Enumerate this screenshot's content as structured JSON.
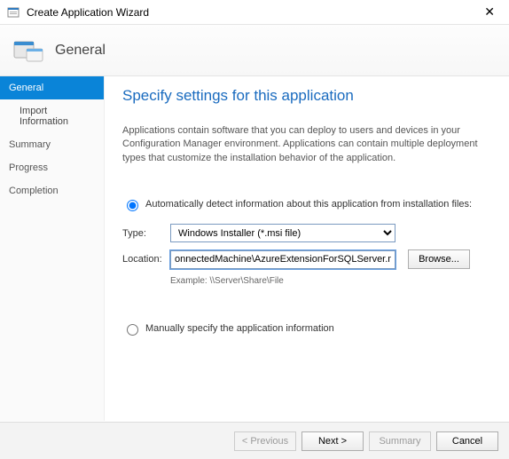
{
  "window": {
    "title": "Create Application Wizard"
  },
  "banner": {
    "title": "General"
  },
  "sidebar": {
    "steps": [
      {
        "label": "General",
        "active": true
      },
      {
        "label": "Import Information",
        "sub": true
      },
      {
        "label": "Summary"
      },
      {
        "label": "Progress"
      },
      {
        "label": "Completion"
      }
    ]
  },
  "main": {
    "heading": "Specify settings for this application",
    "description": "Applications contain software that you can deploy to users and devices in your Configuration Manager environment. Applications can contain multiple deployment types that customize the installation behavior of the application.",
    "option_auto": "Automatically detect information about this application from installation files:",
    "option_manual": "Manually specify the application information",
    "type_label": "Type:",
    "type_value": "Windows Installer (*.msi file)",
    "location_label": "Location:",
    "location_value": "onnectedMachine\\AzureExtensionForSQLServer.msi",
    "example": "Example: \\\\Server\\Share\\File",
    "browse": "Browse..."
  },
  "footer": {
    "previous": "< Previous",
    "next": "Next >",
    "summary": "Summary",
    "cancel": "Cancel"
  }
}
